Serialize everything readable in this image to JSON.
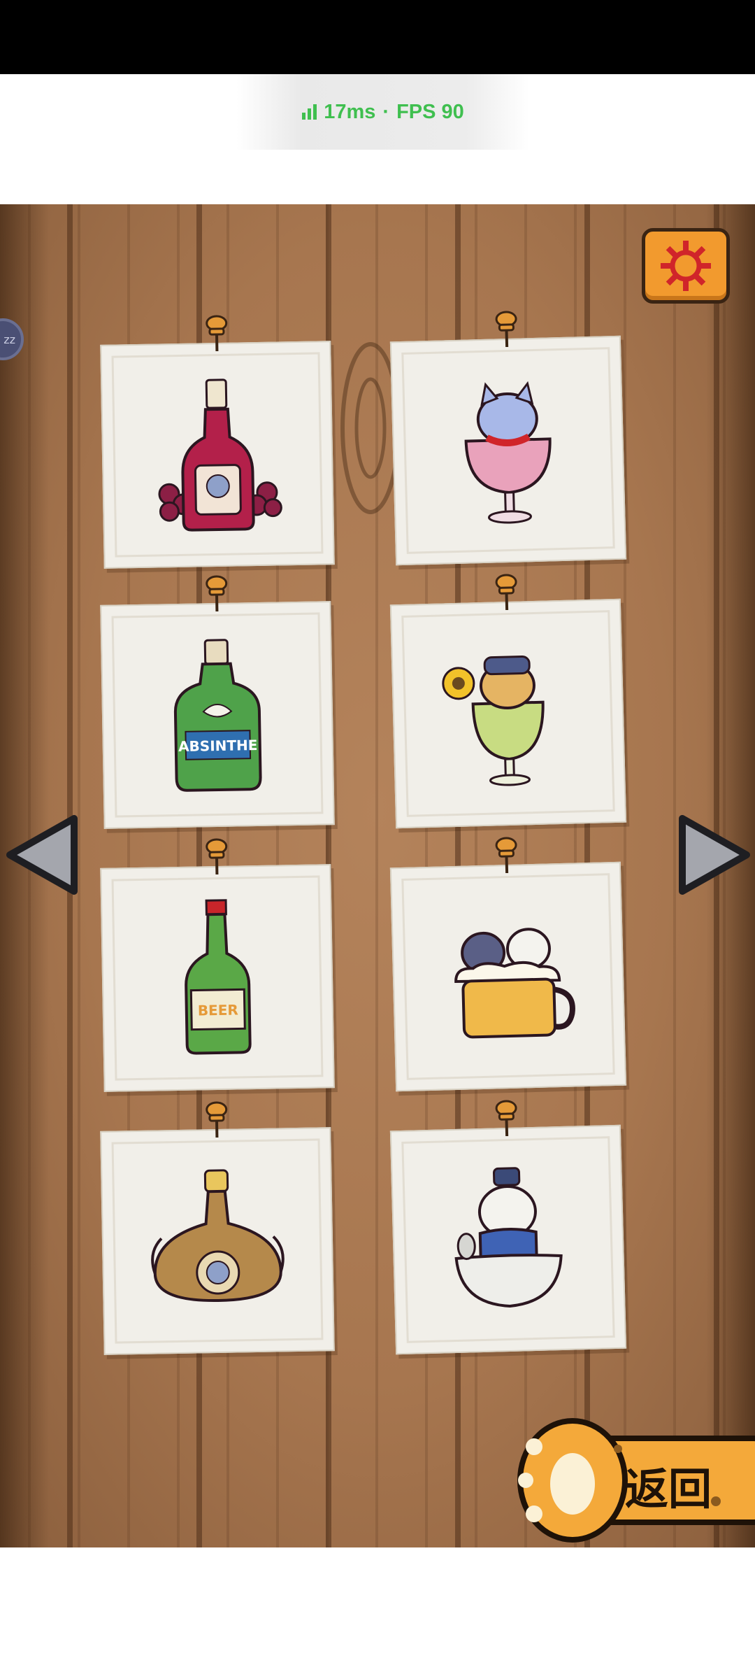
{
  "status": {
    "ping": "17ms",
    "separator": "·",
    "fps": "FPS 90"
  },
  "side_badge": {
    "text": "zz"
  },
  "settings": {
    "icon": "gear-icon"
  },
  "nav": {
    "prev_icon": "left-arrow-icon",
    "next_icon": "right-arrow-icon"
  },
  "cards": [
    {
      "item": "red-wine-bottle"
    },
    {
      "item": "cat-in-wine-glass"
    },
    {
      "item": "absinthe-bottle",
      "label": "ABSINTHE"
    },
    {
      "item": "cat-in-absinthe-glass"
    },
    {
      "item": "beer-bottle",
      "label": "BEER"
    },
    {
      "item": "cats-in-beer-mug"
    },
    {
      "item": "baijiu-bottle"
    },
    {
      "item": "cat-in-bowl"
    }
  ],
  "back_button": {
    "label": "返回"
  },
  "colors": {
    "accent": "#f29a2e",
    "wood": "#a7764f",
    "status_green": "#3fbf4f",
    "card": "#f1efe9"
  }
}
